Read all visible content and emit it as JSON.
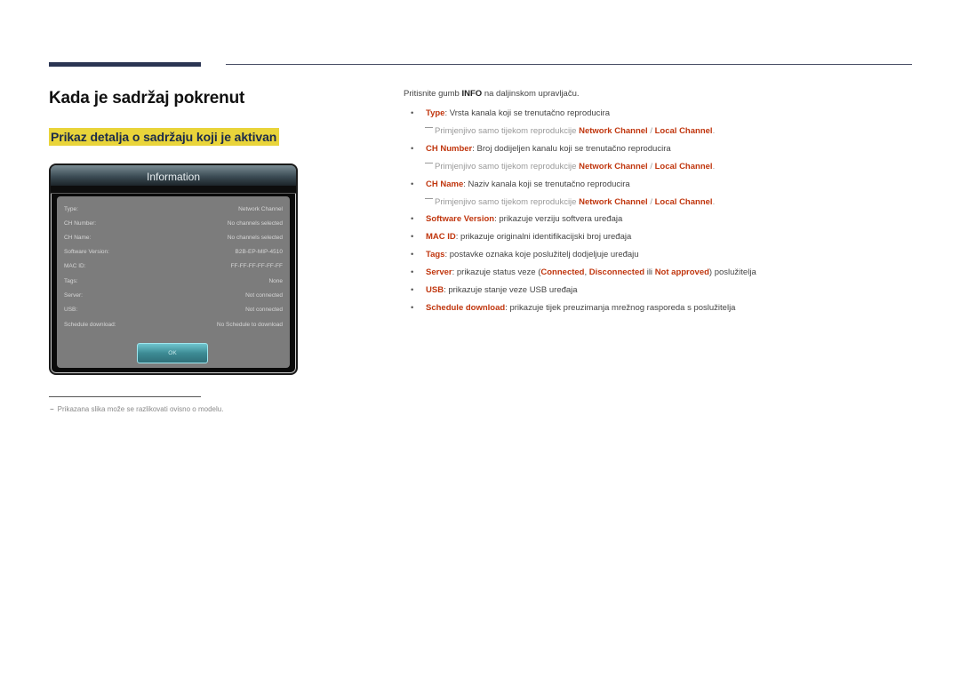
{
  "page": {
    "title": "Kada je sadržaj pokrenut",
    "section_title": "Prikaz detalja o sadržaju koji je aktivan"
  },
  "dialog": {
    "title": "Information",
    "rows": [
      {
        "label": "Type:",
        "value": "Network Channel"
      },
      {
        "label": "CH Number:",
        "value": "No channels selected"
      },
      {
        "label": "CH Name:",
        "value": "No channels selected"
      },
      {
        "label": "Software Version:",
        "value": "B2B-EP-MIP-4510"
      },
      {
        "label": "MAC ID:",
        "value": "FF-FF-FF-FF-FF-FF"
      },
      {
        "label": "Tags:",
        "value": "None"
      },
      {
        "label": "Server:",
        "value": "Not connected"
      },
      {
        "label": "USB:",
        "value": "Not connected"
      },
      {
        "label": "Schedule download:",
        "value": "No Schedule to download"
      }
    ],
    "ok_label": "OK"
  },
  "footnote": {
    "dash": "−",
    "text": "Prikazana slika može se razlikovati ovisno o modelu."
  },
  "instructions": {
    "intro_before": "Pritisnite gumb ",
    "intro_key": "INFO",
    "intro_after": " na daljinskom upravljaču.",
    "bullet": "•",
    "note_prefix": "Primjenjivo samo tijekom reprodukcije ",
    "note_term1": "Network Channel",
    "note_sep": " / ",
    "note_term2": "Local Channel",
    "note_end": ".",
    "items": [
      {
        "term": "Type",
        "desc": ": Vrsta kanala koji se trenutačno reproducira"
      },
      {
        "term": "CH Number",
        "desc": ": Broj dodijeljen kanalu koji se trenutačno reproducira"
      },
      {
        "term": "CH Name",
        "desc": ": Naziv kanala koji se trenutačno reproducira"
      },
      {
        "term": "Software Version",
        "desc": ": prikazuje verziju softvera uređaja"
      },
      {
        "term": "MAC ID",
        "desc": ": prikazuje originalni identifikacijski broj uređaja"
      },
      {
        "term": "Tags",
        "desc": ": postavke oznaka koje poslužitelj dodjeljuje uređaju"
      },
      {
        "term": "Server",
        "desc_before": ": prikazuje status veze (",
        "s1": "Connected",
        "sep1": ", ",
        "s2": "Disconnected",
        "sep2": " ili ",
        "s3": "Not approved",
        "desc_after": ") poslužitelja"
      },
      {
        "term": "USB",
        "desc": ": prikazuje stanje veze USB uređaja"
      },
      {
        "term": "Schedule download",
        "desc": ": prikazuje tijek preuzimanja mrežnog rasporeda s poslužitelja"
      }
    ]
  },
  "colors": {
    "accent_red": "#c0360e",
    "highlight_yellow": "#e9d43a",
    "header_bar": "#2b3553"
  }
}
